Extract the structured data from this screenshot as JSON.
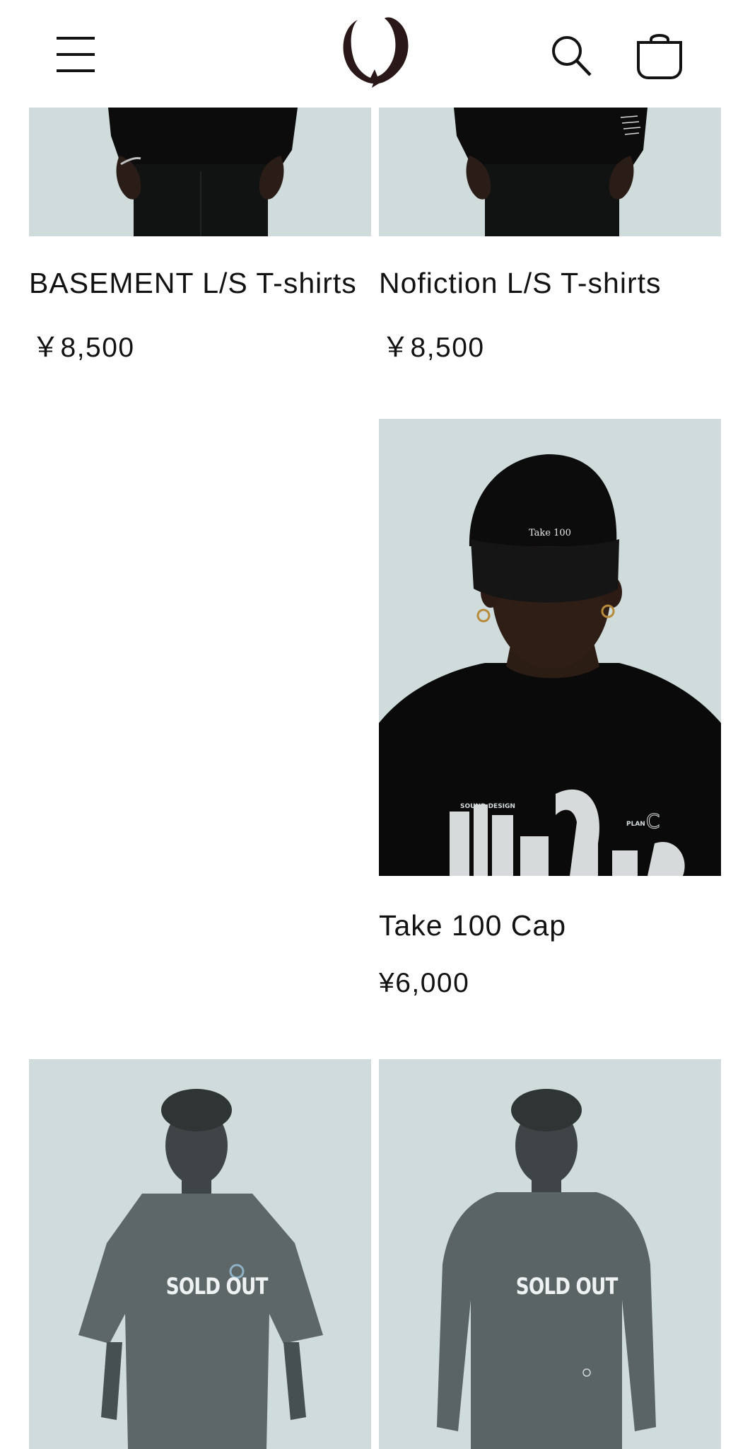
{
  "header": {
    "menu_icon": "hamburger-menu-icon",
    "logo_icon": "brand-logo",
    "search_icon": "search-icon",
    "cart_icon": "cart-icon"
  },
  "products": [
    {
      "title": "BASEMENT L/S T-shirts",
      "price": "￥8,500"
    },
    {
      "title": "Nofiction L/S T-shirts",
      "price": "￥8,500"
    },
    {
      "title": "Take 100 Cap",
      "price": "¥6,000",
      "image_text": "Take 100"
    },
    {
      "badge": "SOLD OUT"
    },
    {
      "badge": "SOLD OUT"
    }
  ],
  "colors": {
    "image_background": "#cfdcdb",
    "text": "#121212",
    "logo": "#2a1718"
  }
}
